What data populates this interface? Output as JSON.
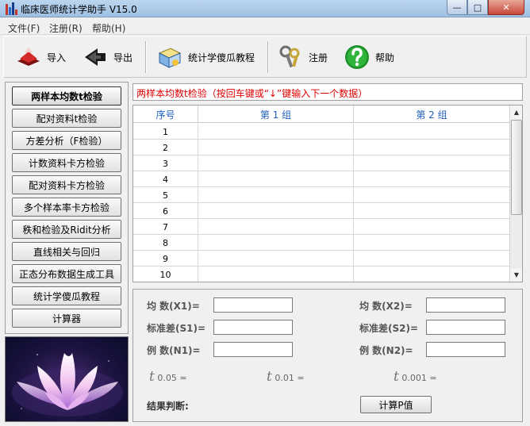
{
  "window": {
    "title": "临床医师统计学助手 V15.0",
    "min": "—",
    "max": "□",
    "close": "✕"
  },
  "menu": [
    "文件(F)",
    "注册(R)",
    "帮助(H)"
  ],
  "toolbar": {
    "import_label": "导入",
    "export_label": "导出",
    "tutorial_label": "统计学傻瓜教程",
    "register_label": "注册",
    "help_label": "帮助"
  },
  "nav": [
    "两样本均数t检验",
    "配对资料t检验",
    "方差分析（F检验）",
    "计数资料卡方检验",
    "配对资料卡方检验",
    "多个样本率卡方检验",
    "秩和检验及Ridit分析",
    "直线相关与回归",
    "正态分布数据生成工具",
    "统计学傻瓜教程",
    "计算器"
  ],
  "main": {
    "headline": "两样本均数t检验（按回车键或“↓”键输入下一个数据）",
    "grid": {
      "headers": [
        "序号",
        "第 1 组",
        "第 2 组"
      ],
      "rows": [
        "1",
        "2",
        "3",
        "4",
        "5",
        "6",
        "7",
        "8",
        "9",
        "10"
      ]
    }
  },
  "results": {
    "mean1": "均   数(X1)=",
    "mean2": "均   数(X2)=",
    "sd1": "标准差(S1)=",
    "sd2": "标准差(S2)=",
    "n1": "例   数(N1)=",
    "n2": "例   数(N2)=",
    "t_symbol": "t",
    "t005": "0.05 =",
    "t001": "0.01 =",
    "t0001": "0.001 =",
    "conclusion_label": "结果判断:",
    "calc_button": "计算P值"
  },
  "colors": {
    "headline_red": "#e00000",
    "grid_header_blue": "#1f5fc0"
  }
}
